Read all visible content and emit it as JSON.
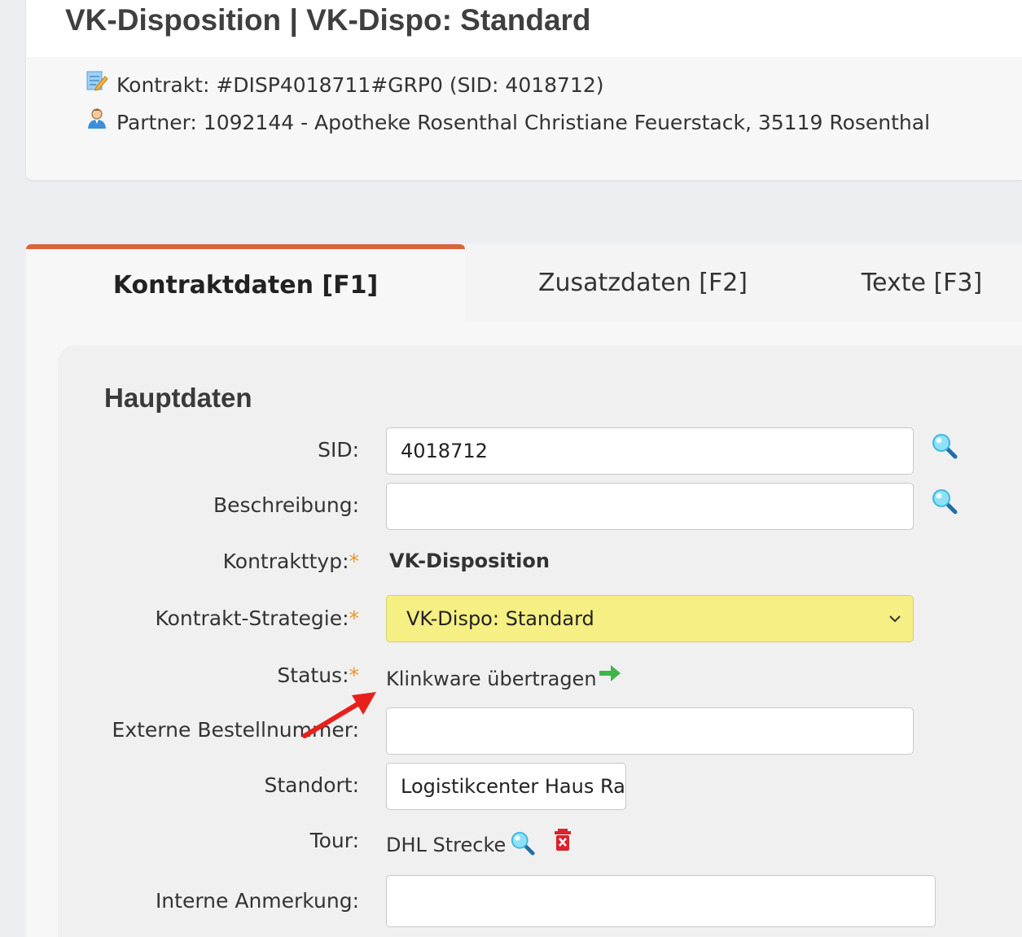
{
  "header": {
    "title": "VK-Disposition | VK-Dispo: Standard",
    "contract_line": "Kontrakt: #DISP4018711#GRP0 (SID: 4018712)",
    "partner_line": "Partner: 1092144 - Apotheke Rosenthal Christiane Feuerstack, 35119 Rosenthal"
  },
  "tabs": [
    {
      "label": "Kontraktdaten [F1]",
      "active": true
    },
    {
      "label": "Zusatzdaten [F2]",
      "active": false
    },
    {
      "label": "Texte [F3]",
      "active": false
    }
  ],
  "section": {
    "title": "Hauptdaten"
  },
  "form": {
    "sid": {
      "label": "SID:",
      "value": "4018712"
    },
    "beschreibung": {
      "label": "Beschreibung:",
      "value": ""
    },
    "kontrakttyp": {
      "label": "Kontrakttyp:",
      "value": "VK-Disposition"
    },
    "strategie": {
      "label": "Kontrakt-Strategie:",
      "value": "VK-Dispo: Standard"
    },
    "status": {
      "label": "Status:",
      "value": "Klinkware übertragen"
    },
    "externe": {
      "label": "Externe Bestellnummer:",
      "value": ""
    },
    "standort": {
      "label": "Standort:",
      "value": "Logistikcenter Haus Ra"
    },
    "tour": {
      "label": "Tour:",
      "value": "DHL Strecke"
    },
    "anmerkung": {
      "label": "Interne Anmerkung:",
      "value": ""
    },
    "required_marker": "*"
  },
  "icons": {
    "contract": "contract-edit-icon",
    "partner": "person-icon",
    "search": "magnifier-icon",
    "status_arrow": "arrow-right-icon",
    "delete": "trash-icon",
    "annotation": "red-arrow"
  },
  "colors": {
    "tab_accent": "#d8653d",
    "select_bg": "#f5ef84",
    "required": "#f39325",
    "status_arrow": "#3db54a",
    "annotation": "#e8201c"
  }
}
